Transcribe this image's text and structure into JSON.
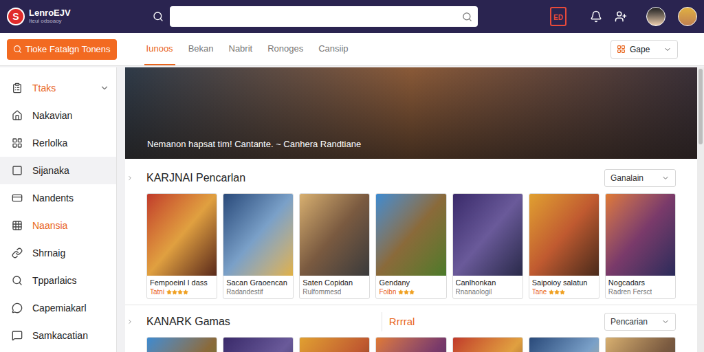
{
  "header": {
    "logo_mark": "S",
    "logo_name": "LenroEJV",
    "logo_tagline": "Iteui odsoaoy",
    "badge": "ED"
  },
  "toolbar": {
    "action_button": "Tioke Fatalgn Tonens",
    "tabs": [
      {
        "label": "Iunoos",
        "selected": true
      },
      {
        "label": "Bekan",
        "selected": false
      },
      {
        "label": "Nabrit",
        "selected": false
      },
      {
        "label": "Ronoges",
        "selected": false
      },
      {
        "label": "Cansiip",
        "selected": false
      }
    ],
    "dropdown": "Gape"
  },
  "sidebar": {
    "group": {
      "label": "Ttaks",
      "expanded": true
    },
    "items": [
      {
        "label": "Nakavian",
        "selected": false,
        "accent": false
      },
      {
        "label": "Rerlolka",
        "selected": false,
        "accent": false
      },
      {
        "label": "Sijanaka",
        "selected": true,
        "accent": false
      },
      {
        "label": "Nandents",
        "selected": false,
        "accent": false
      },
      {
        "label": "Naansia",
        "selected": false,
        "accent": true
      },
      {
        "label": "Shrnaig",
        "selected": false,
        "accent": false
      },
      {
        "label": "Tpparlaics",
        "selected": false,
        "accent": false
      },
      {
        "label": "Capemiakarl",
        "selected": false,
        "accent": false
      },
      {
        "label": "Samkacatian",
        "selected": false,
        "accent": false
      }
    ]
  },
  "banner": {
    "caption": "Nemanon hapsat tim! Cantante. ~ Canhera Randtiane"
  },
  "sections": [
    {
      "title": "KARJNAI Pencarlan",
      "aside_title": "",
      "dropdown": "Ganalain",
      "cards": [
        {
          "title": "Fempoeinl I dass",
          "subtitle": "Tatni",
          "stars": 4
        },
        {
          "title": "Sacan Graoencan",
          "subtitle": "Radandestif",
          "stars": 0
        },
        {
          "title": "Saten Copidan",
          "subtitle": "Rulfommesd",
          "stars": 0
        },
        {
          "title": "Gendany",
          "subtitle": "Foibn",
          "stars": 3
        },
        {
          "title": "Canlhonkan",
          "subtitle": "Rnanaologil",
          "stars": 0
        },
        {
          "title": "Saipoioy salatun",
          "subtitle": "Tane",
          "stars": 3
        },
        {
          "title": "Nogcadars",
          "subtitle": "Radren Fersct",
          "stars": 0
        }
      ]
    },
    {
      "title": "KANARK Gamas",
      "aside_title": "Rrrral",
      "dropdown": "Pencarian",
      "cards": [
        {
          "title": "",
          "subtitle": "",
          "stars": 0
        },
        {
          "title": "",
          "subtitle": "",
          "stars": 0
        },
        {
          "title": "",
          "subtitle": "",
          "stars": 0
        },
        {
          "title": "",
          "subtitle": "",
          "stars": 0
        },
        {
          "title": "",
          "subtitle": "",
          "stars": 0
        },
        {
          "title": "",
          "subtitle": "",
          "stars": 0
        },
        {
          "title": "",
          "subtitle": "",
          "stars": 0
        }
      ]
    }
  ]
}
